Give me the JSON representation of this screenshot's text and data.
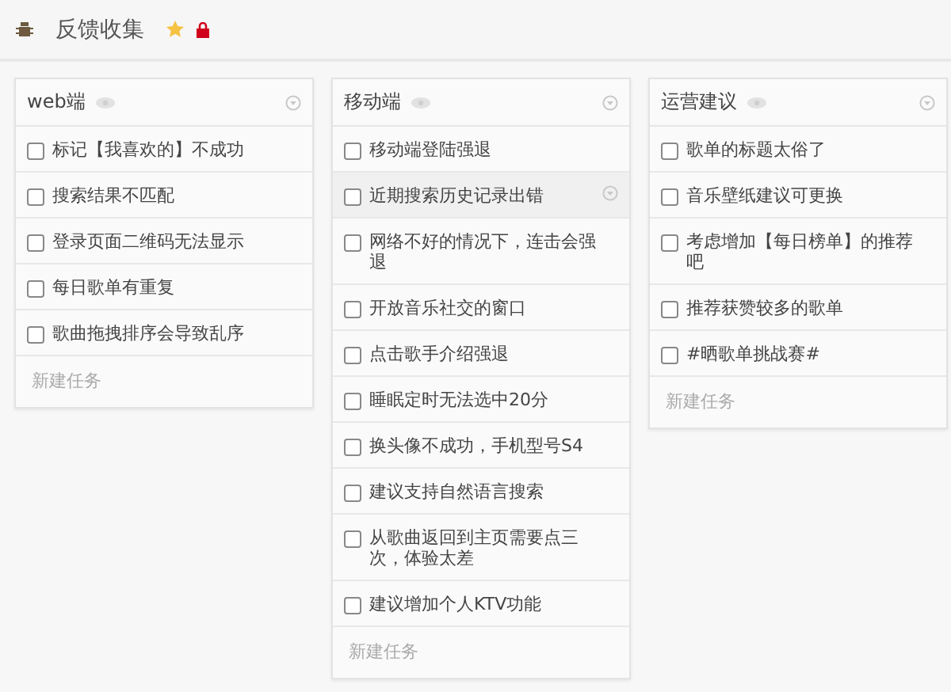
{
  "header": {
    "title": "反馈收集",
    "starred": true,
    "locked": true
  },
  "lists": [
    {
      "title": "web端",
      "tasks": [
        {
          "text": "标记【我喜欢的】不成功",
          "checked": false,
          "highlighted": false
        },
        {
          "text": "搜索结果不匹配",
          "checked": false,
          "highlighted": false
        },
        {
          "text": "登录页面二维码无法显示",
          "checked": false,
          "highlighted": false
        },
        {
          "text": "每日歌单有重复",
          "checked": false,
          "highlighted": false
        },
        {
          "text": "歌曲拖拽排序会导致乱序",
          "checked": false,
          "highlighted": false
        }
      ],
      "new_task": "新建任务"
    },
    {
      "title": "移动端",
      "tasks": [
        {
          "text": "移动端登陆强退",
          "checked": false,
          "highlighted": false
        },
        {
          "text": "近期搜索历史记录出错",
          "checked": false,
          "highlighted": true
        },
        {
          "text": "网络不好的情况下，连击会强退",
          "checked": false,
          "highlighted": false
        },
        {
          "text": "开放音乐社交的窗口",
          "checked": false,
          "highlighted": false
        },
        {
          "text": "点击歌手介绍强退",
          "checked": false,
          "highlighted": false
        },
        {
          "text": "睡眠定时无法选中20分",
          "checked": false,
          "highlighted": false
        },
        {
          "text": "换头像不成功，手机型号S4",
          "checked": false,
          "highlighted": false
        },
        {
          "text": "建议支持自然语言搜索",
          "checked": false,
          "highlighted": false
        },
        {
          "text": "从歌曲返回到主页需要点三次，体验太差",
          "checked": false,
          "highlighted": false
        },
        {
          "text": "建议增加个人KTV功能",
          "checked": false,
          "highlighted": false
        }
      ],
      "new_task": "新建任务"
    },
    {
      "title": "运营建议",
      "tasks": [
        {
          "text": "歌单的标题太俗了",
          "checked": false,
          "highlighted": false
        },
        {
          "text": "音乐壁纸建议可更换",
          "checked": false,
          "highlighted": false
        },
        {
          "text": "考虑增加【每日榜单】的推荐吧",
          "checked": false,
          "highlighted": false
        },
        {
          "text": "推荐获赞较多的歌单",
          "checked": false,
          "highlighted": false
        },
        {
          "text": "#晒歌单挑战赛#",
          "checked": false,
          "highlighted": false
        }
      ],
      "new_task": "新建任务"
    }
  ]
}
